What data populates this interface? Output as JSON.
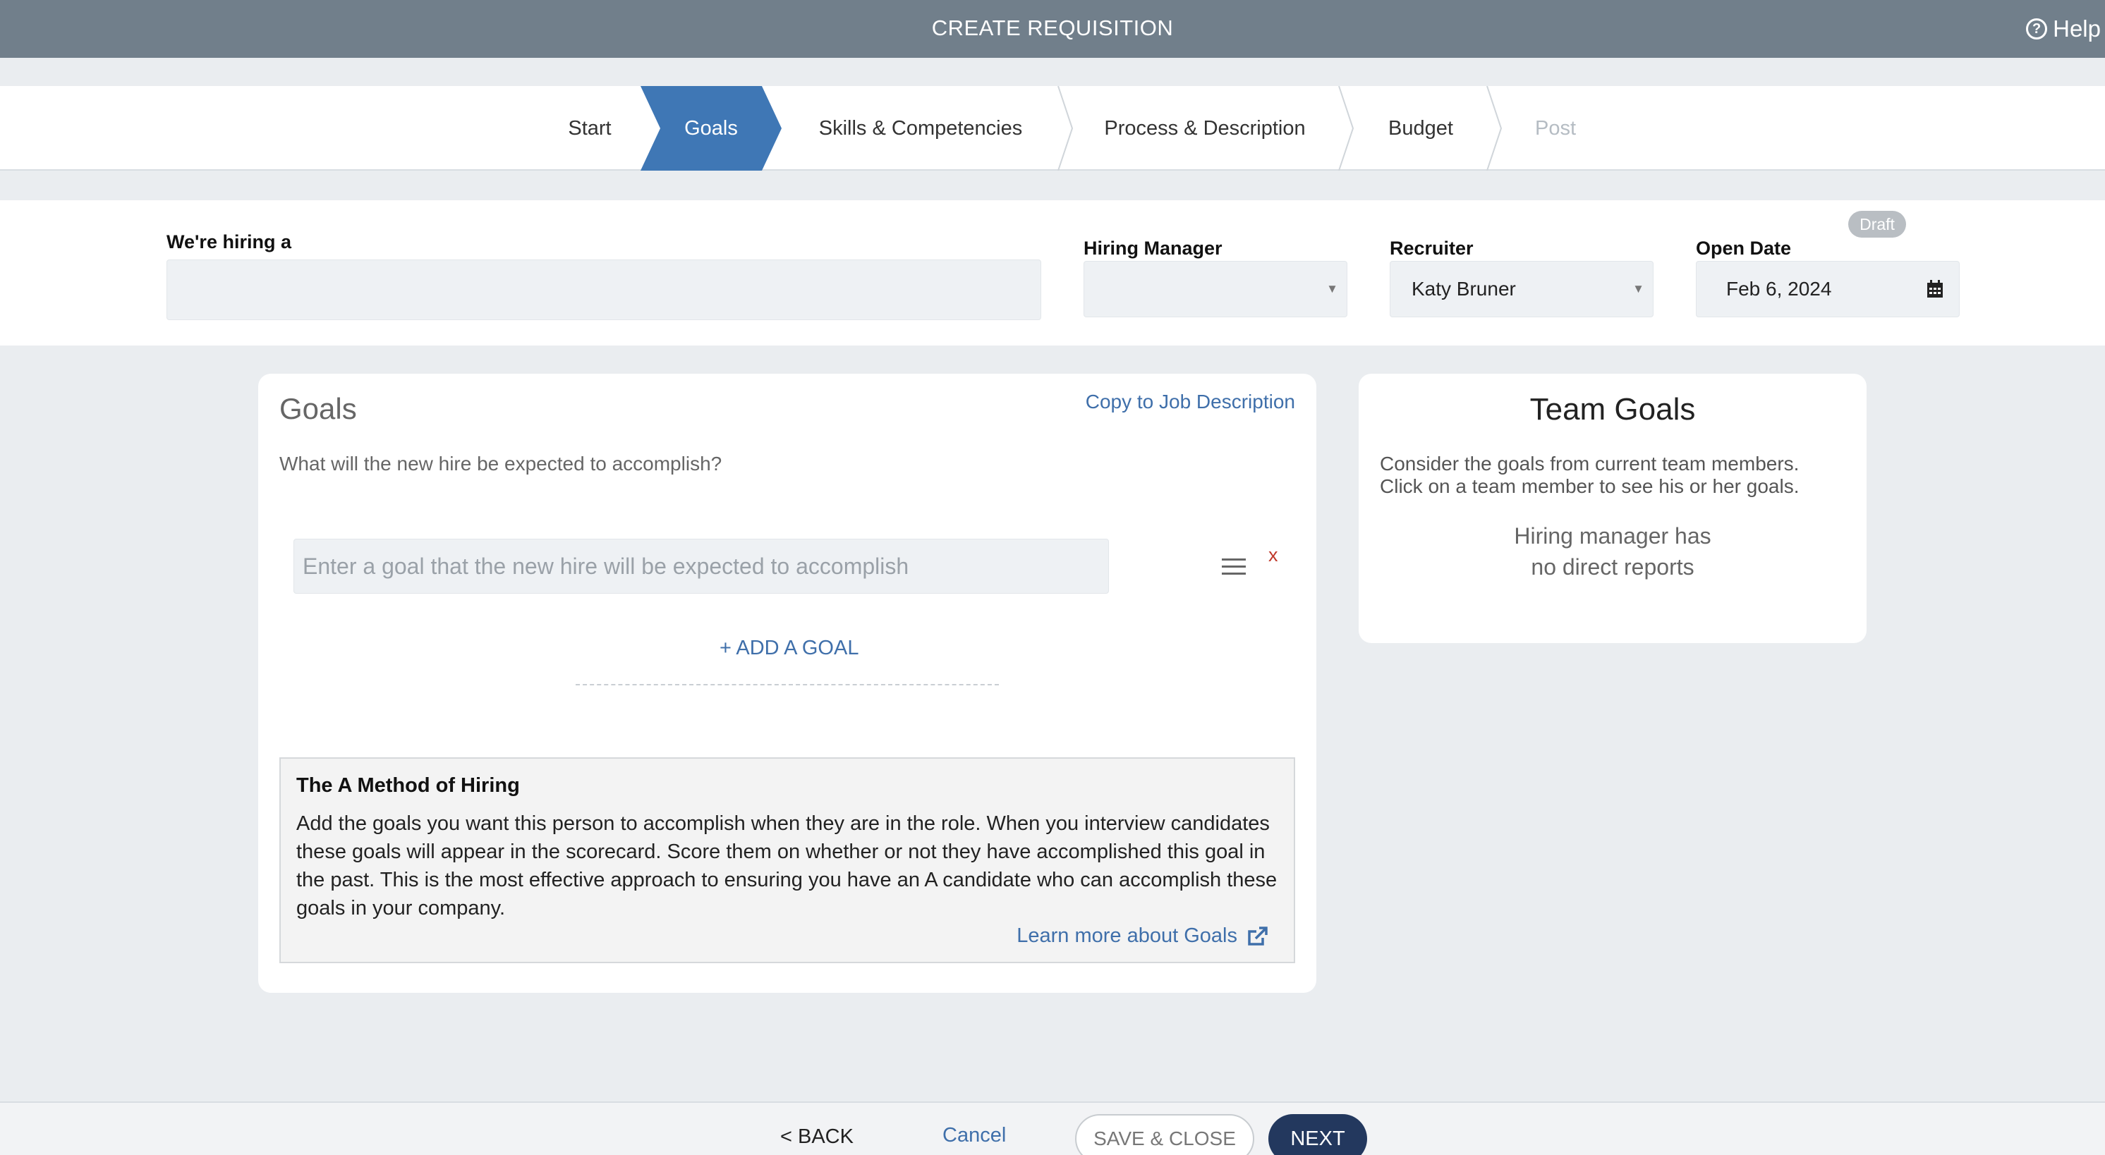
{
  "topbar": {
    "title": "CREATE REQUISITION",
    "help_label": "Help",
    "help_glyph": "?"
  },
  "steps": [
    {
      "label": "Start",
      "state": "done"
    },
    {
      "label": "Goals",
      "state": "active"
    },
    {
      "label": "Skills & Competencies",
      "state": "pending"
    },
    {
      "label": "Process & Description",
      "state": "pending"
    },
    {
      "label": "Budget",
      "state": "pending"
    },
    {
      "label": "Post",
      "state": "disabled"
    }
  ],
  "header": {
    "hiring_label": "We're hiring a",
    "hiring_value": "",
    "manager_label": "Hiring Manager",
    "manager_value": "",
    "recruiter_label": "Recruiter",
    "recruiter_value": "Katy Bruner",
    "open_date_label": "Open Date",
    "open_date_value": "Feb 6, 2024",
    "status_badge": "Draft"
  },
  "goals": {
    "title": "Goals",
    "copy_link": "Copy to Job Description",
    "subtitle": "What will the new hire be expected to accomplish?",
    "input_placeholder": "Enter a goal that the new hire will be expected to accomplish",
    "remove_label": "x",
    "add_goal": "+ ADD A GOAL"
  },
  "a_method": {
    "title": "The A Method of Hiring",
    "body": "Add the goals you want this person to accomplish when they are in the role. When you interview candidates these goals will appear in the scorecard. Score them on whether or not they have accomplished this goal in the past. This is the most effective approach to ensuring you have an A candidate who can accomplish these goals in your company.",
    "learn_more": "Learn more about Goals"
  },
  "team_goals": {
    "title": "Team Goals",
    "description": "Consider the goals from current team members. Click on a team member to see his or her goals.",
    "empty_message": "Hiring manager has no direct reports"
  },
  "footer": {
    "back": "< BACK",
    "cancel": "Cancel",
    "save_close": "SAVE & CLOSE",
    "next": "NEXT"
  },
  "colors": {
    "topbar": "#717f8b",
    "active_step": "#3f77b5",
    "link": "#3f6faa",
    "next_button": "#23385e",
    "remove": "#c0392b"
  },
  "icons": {
    "help": "help-circle-icon",
    "caret": "caret-down-icon",
    "calendar": "calendar-icon",
    "drag": "drag-handle-icon",
    "external": "external-link-icon"
  }
}
